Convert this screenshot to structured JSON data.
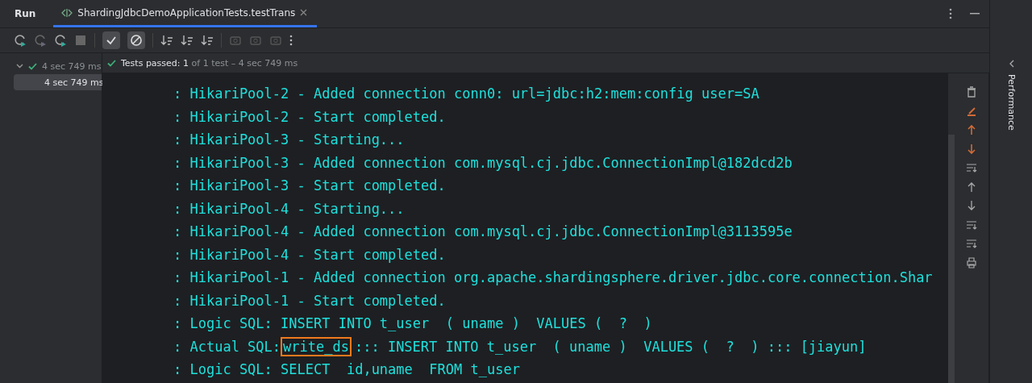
{
  "header": {
    "title": "Run",
    "tab": {
      "label": "ShardingJdbcDemoApplicationTests.testTrans",
      "selected": true
    }
  },
  "toolbar": {
    "toggles": [
      {
        "kind": "passed",
        "selected": true
      },
      {
        "kind": "ignored",
        "selected": true
      }
    ]
  },
  "tree": {
    "items": [
      {
        "label": "4 sec 749 ms",
        "expanded": true,
        "passed": true,
        "selected": false,
        "children": [
          {
            "label": "4 sec 749 ms",
            "selected": true
          }
        ]
      }
    ]
  },
  "status": {
    "label": "Tests passed:",
    "count": "1",
    "rest": "of 1 test – 4 sec 749 ms"
  },
  "console": {
    "lines": [
      {
        "parts": [
          {
            "text": ": HikariPool-2 - Added connection conn0: url=jdbc:h2:mem:config user=SA",
            "boxed": false
          }
        ]
      },
      {
        "parts": [
          {
            "text": ": HikariPool-2 - Start completed.",
            "boxed": false
          }
        ]
      },
      {
        "parts": [
          {
            "text": ": HikariPool-3 - Starting...",
            "boxed": false
          }
        ]
      },
      {
        "parts": [
          {
            "text": ": HikariPool-3 - Added connection com.mysql.cj.jdbc.ConnectionImpl@182dcd2b",
            "boxed": false
          }
        ]
      },
      {
        "parts": [
          {
            "text": ": HikariPool-3 - Start completed.",
            "boxed": false
          }
        ]
      },
      {
        "parts": [
          {
            "text": ": HikariPool-4 - Starting...",
            "boxed": false
          }
        ]
      },
      {
        "parts": [
          {
            "text": ": HikariPool-4 - Added connection com.mysql.cj.jdbc.ConnectionImpl@3113595e",
            "boxed": false
          }
        ]
      },
      {
        "parts": [
          {
            "text": ": HikariPool-4 - Start completed.",
            "boxed": false
          }
        ]
      },
      {
        "parts": [
          {
            "text": ": HikariPool-1 - Added connection org.apache.shardingsphere.driver.jdbc.core.connection.Shar",
            "boxed": false
          }
        ]
      },
      {
        "parts": [
          {
            "text": ": HikariPool-1 - Start completed.",
            "boxed": false
          }
        ]
      },
      {
        "parts": [
          {
            "text": ": Logic SQL: INSERT INTO t_user  ( uname )  VALUES (  ?  )",
            "boxed": false
          }
        ]
      },
      {
        "parts": [
          {
            "text": ": Actual SQL:",
            "boxed": false
          },
          {
            "text": "write_ds",
            "boxed": true
          },
          {
            "text": "::: INSERT INTO t_user  ( uname )  VALUES (  ?  ) ::: [jiayun]",
            "boxed": false
          }
        ]
      },
      {
        "parts": [
          {
            "text": ": Logic SQL: SELECT  id,uname  FROM t_user",
            "boxed": false
          }
        ]
      }
    ]
  },
  "side_panel": {
    "label": "Performance"
  }
}
